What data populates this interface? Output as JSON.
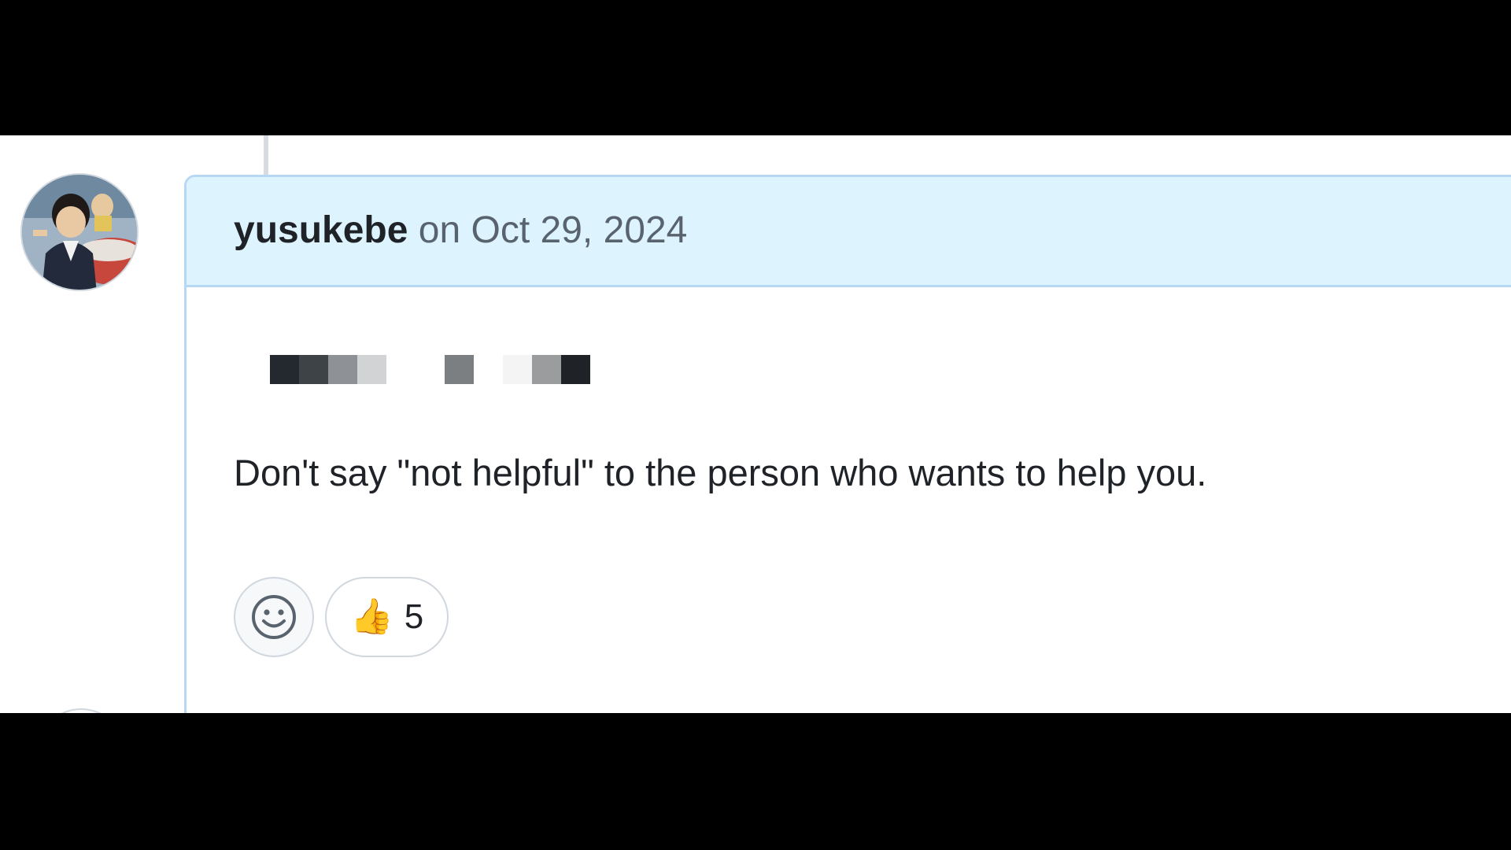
{
  "comment": {
    "author": "yusukebe",
    "timestamp": "on Oct 29, 2024",
    "body": "Don't say \"not helpful\" to the person who wants to help you."
  },
  "reactions": {
    "add_reaction_icon": "smiley-icon",
    "items": [
      {
        "emoji": "👍",
        "icon": "thumbs-up-icon",
        "count": "5"
      }
    ]
  },
  "colors": {
    "header_bg": "#ddf4ff",
    "border": "#b6d8f5",
    "text": "#1f2328",
    "muted": "#59636e"
  }
}
